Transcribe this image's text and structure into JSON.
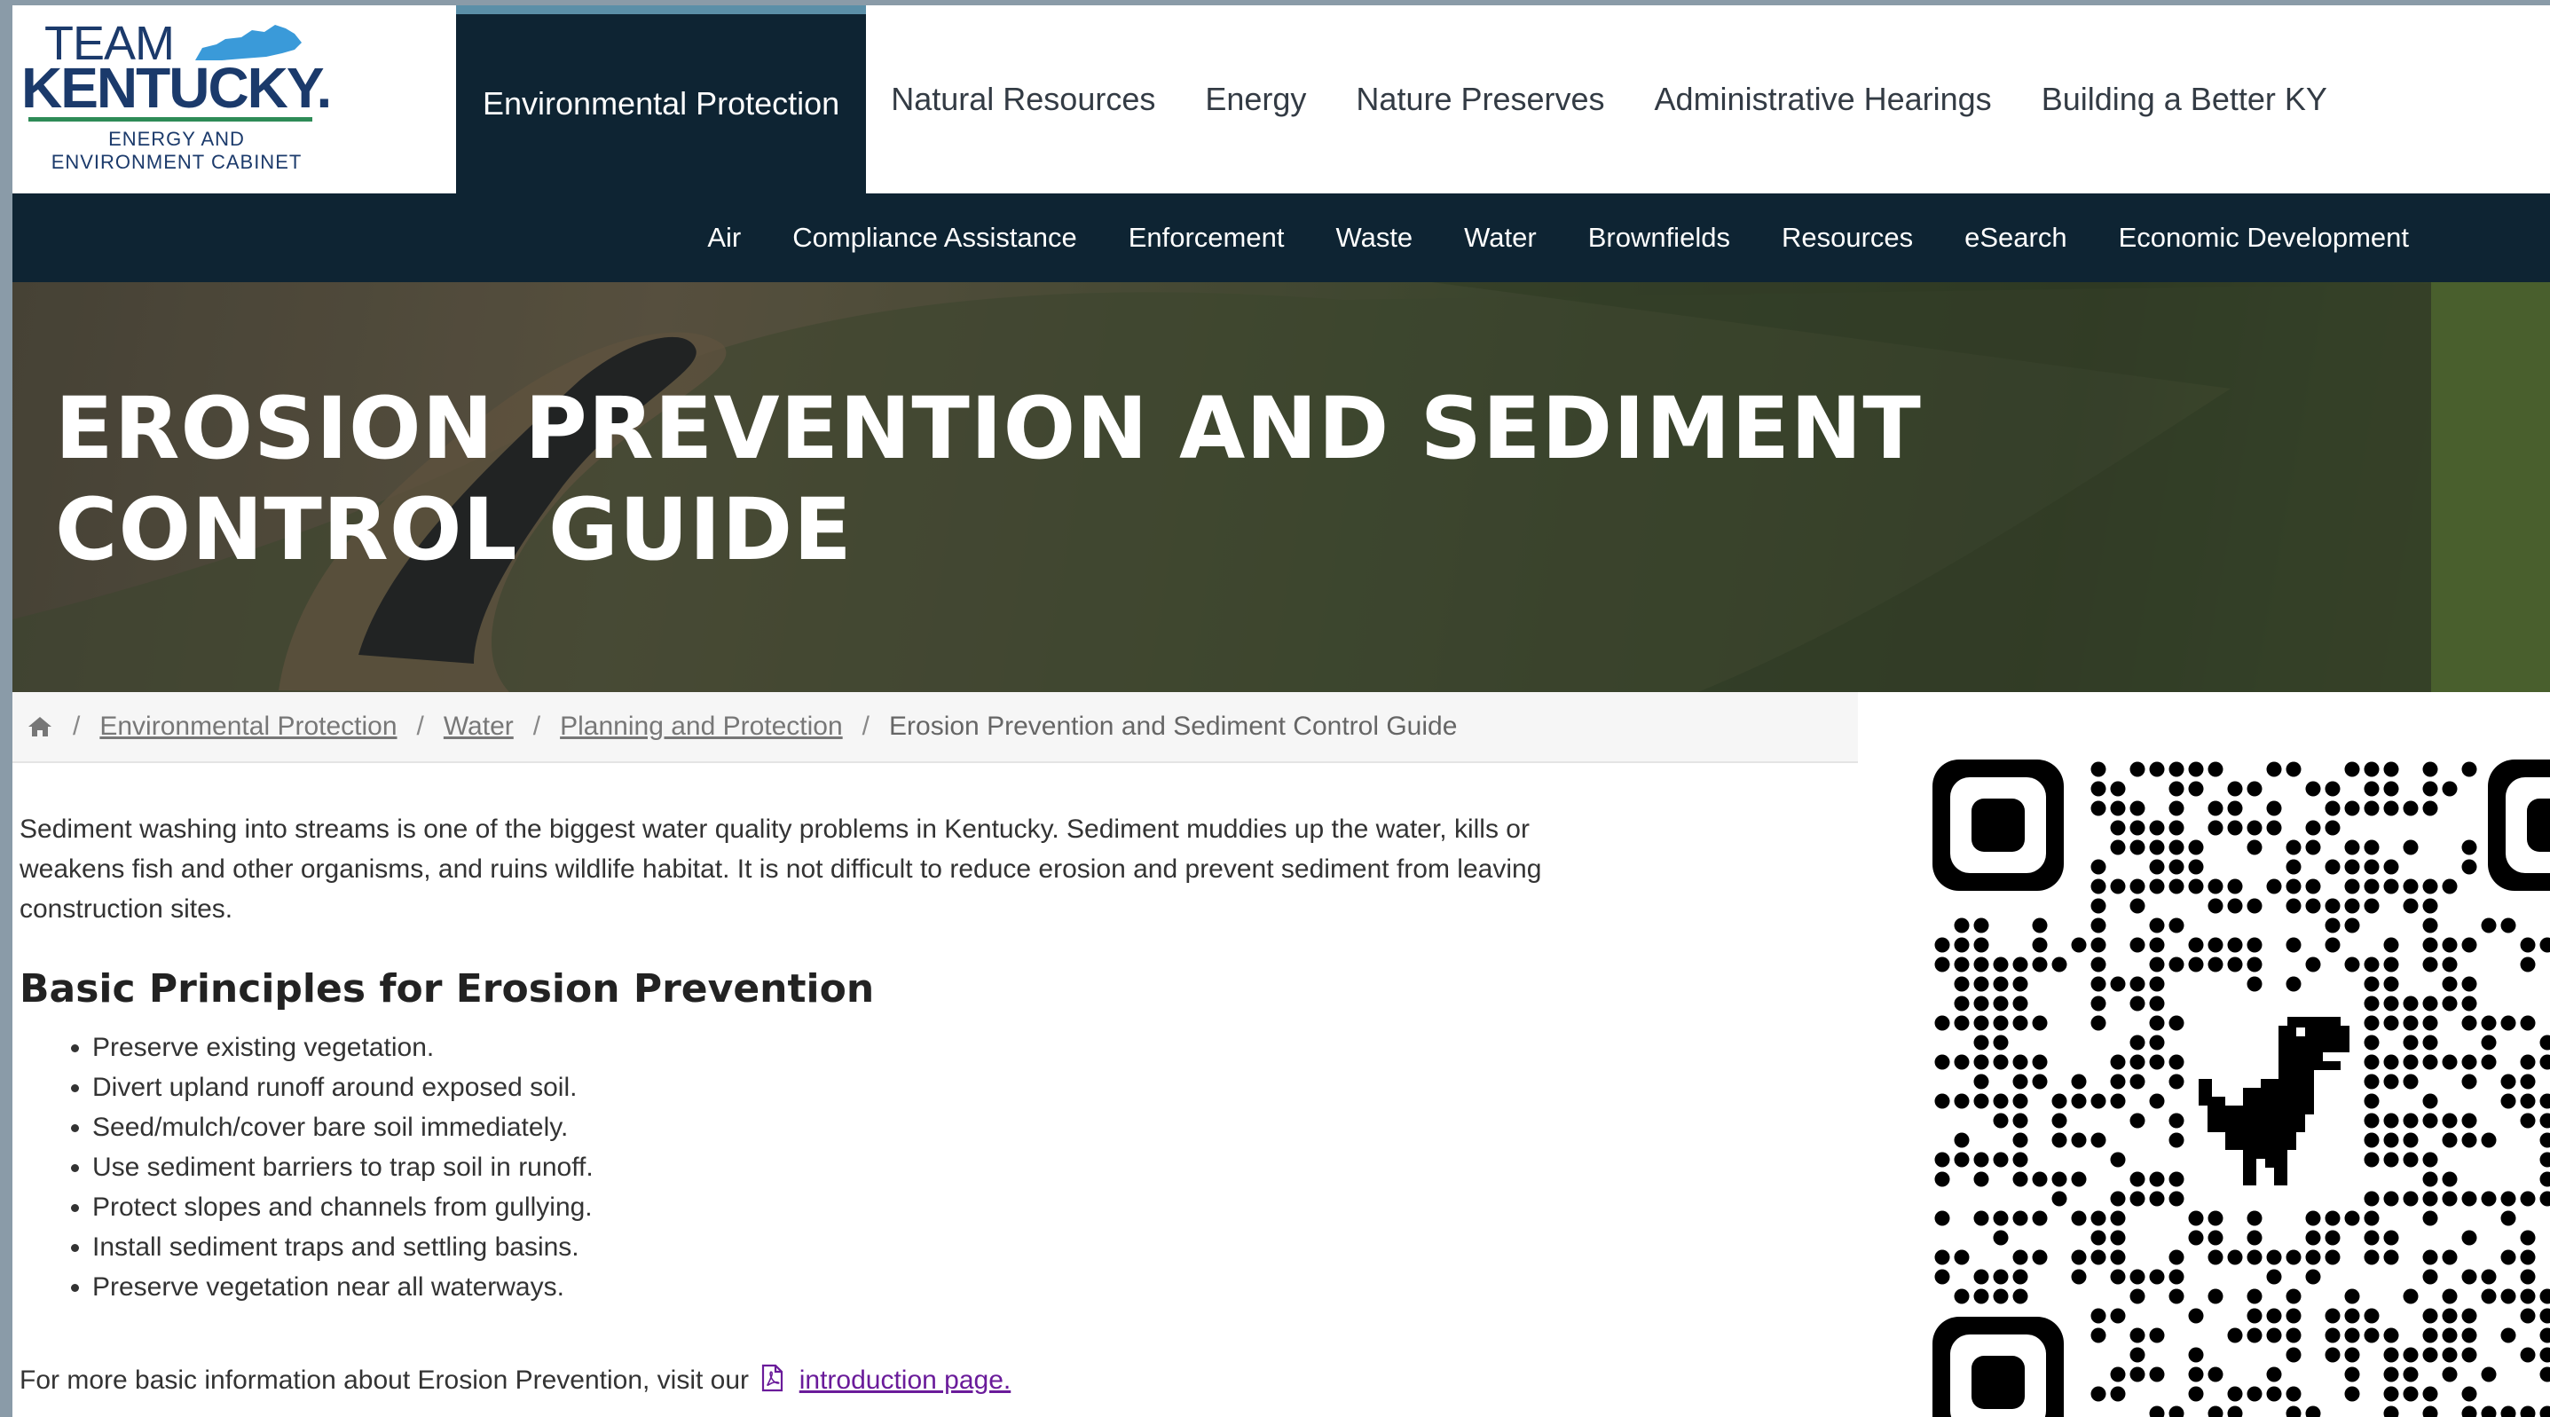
{
  "logo": {
    "team": "TEAM",
    "state": "KENTUCKY.",
    "subtitle_line1": "ENERGY AND",
    "subtitle_line2": "ENVIRONMENT CABINET"
  },
  "top_nav": [
    {
      "label": "Environmental Protection",
      "active": true
    },
    {
      "label": "Natural Resources"
    },
    {
      "label": "Energy"
    },
    {
      "label": "Nature Preserves"
    },
    {
      "label": "Administrative Hearings"
    },
    {
      "label": "Building a Better KY"
    }
  ],
  "sub_nav": [
    "Air",
    "Compliance Assistance",
    "Enforcement",
    "Waste",
    "Water",
    "Brownfields",
    "Resources",
    "eSearch",
    "Economic Development"
  ],
  "hero": {
    "title": "EROSION PREVENTION AND SEDIMENT CONTROL GUIDE"
  },
  "breadcrumb": {
    "separator": "/",
    "links": [
      "Environmental Protection",
      "Water",
      "Planning and Protection"
    ],
    "current": "Erosion Prevention and Sediment Control Guide"
  },
  "content": {
    "intro": "Sediment washing into streams is one of the biggest water quality problems in Kentucky. Sediment muddies up the water, kills or weakens fish and other organisms, and ruins wildlife habitat. It is not difficult to reduce erosion and prevent sediment from leaving construction sites.",
    "section_title": "Basic Principles for Erosion Prevention",
    "principles": [
      "Preserve existing vegetation.",
      "Divert upland runoff around exposed soil.",
      "Seed/mulch/cover bare soil immediately.",
      "Use sediment barriers to trap soil in runoff.",
      "Protect slopes and channels from gullying.",
      "Install sediment traps and settling basins.",
      "Preserve vegetation near all waterways."
    ],
    "footer_text": "For more basic information about Erosion Prevention, visit our",
    "footer_link": "introduction page."
  },
  "colors": {
    "nav_dark": "#0e2433",
    "active_accent": "#5b8fa8",
    "logo_blue": "#1b3a6b",
    "logo_green": "#2e8b57",
    "link_purple": "#6a1b9a"
  },
  "icons": [
    "home-icon",
    "pdf-icon",
    "kentucky-map-icon",
    "qr-code-icon"
  ]
}
